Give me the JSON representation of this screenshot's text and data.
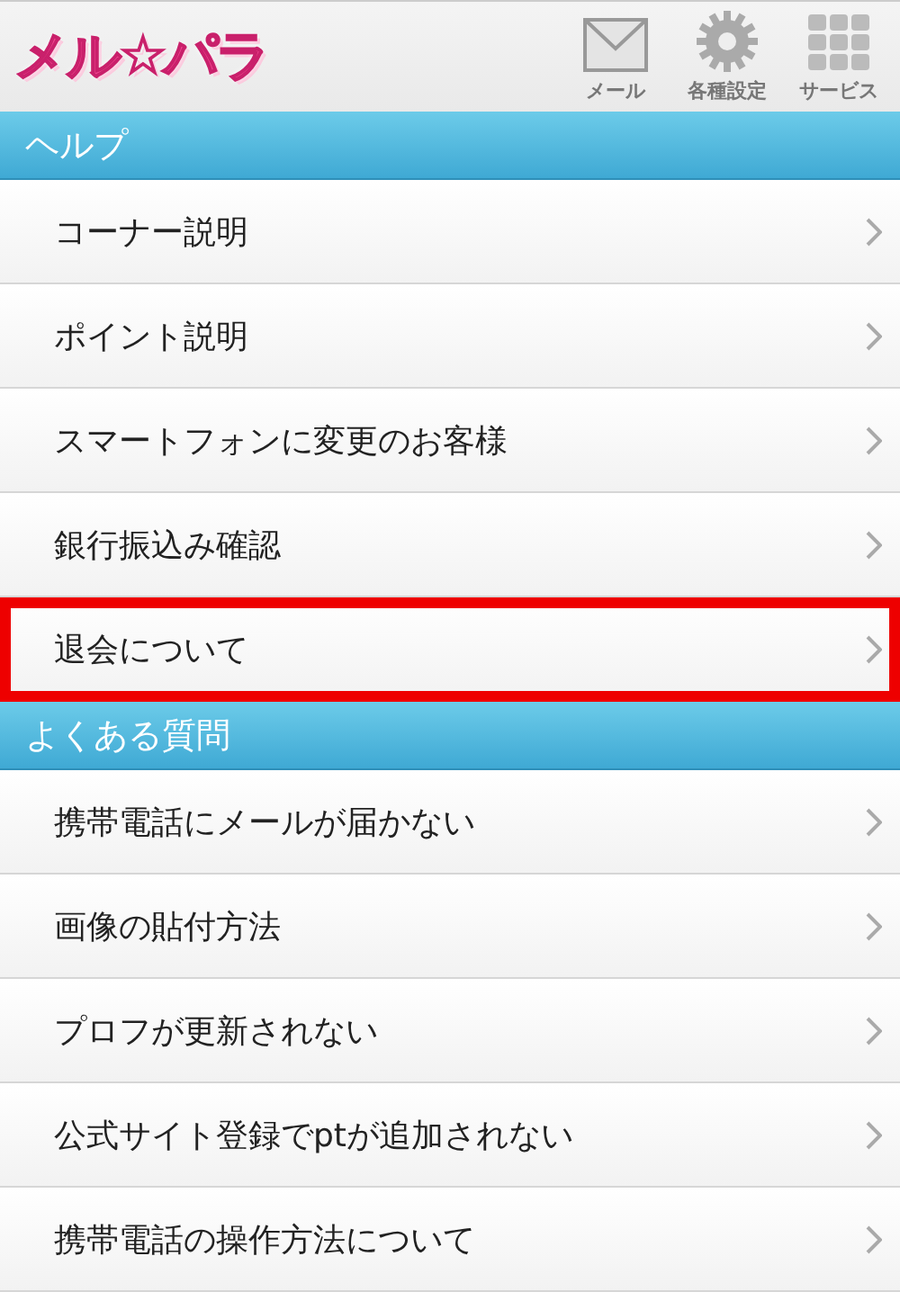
{
  "header": {
    "logo": "メル☆パラ",
    "nav": [
      {
        "kind": "mail",
        "label": "メール"
      },
      {
        "kind": "settings",
        "label": "各種設定"
      },
      {
        "kind": "services",
        "label": "サービス"
      }
    ]
  },
  "sections": [
    {
      "title": "ヘルプ",
      "items": [
        {
          "label": "コーナー説明",
          "highlighted": false
        },
        {
          "label": "ポイント説明",
          "highlighted": false
        },
        {
          "label": "スマートフォンに変更のお客様",
          "highlighted": false
        },
        {
          "label": "銀行振込み確認",
          "highlighted": false
        },
        {
          "label": "退会について",
          "highlighted": true
        }
      ]
    },
    {
      "title": "よくある質問",
      "items": [
        {
          "label": "携帯電話にメールが届かない",
          "highlighted": false
        },
        {
          "label": "画像の貼付方法",
          "highlighted": false
        },
        {
          "label": "プロフが更新されない",
          "highlighted": false
        },
        {
          "label": "公式サイト登録でptが追加されない",
          "highlighted": false
        },
        {
          "label": "携帯電話の操作方法について",
          "highlighted": false
        }
      ]
    }
  ]
}
